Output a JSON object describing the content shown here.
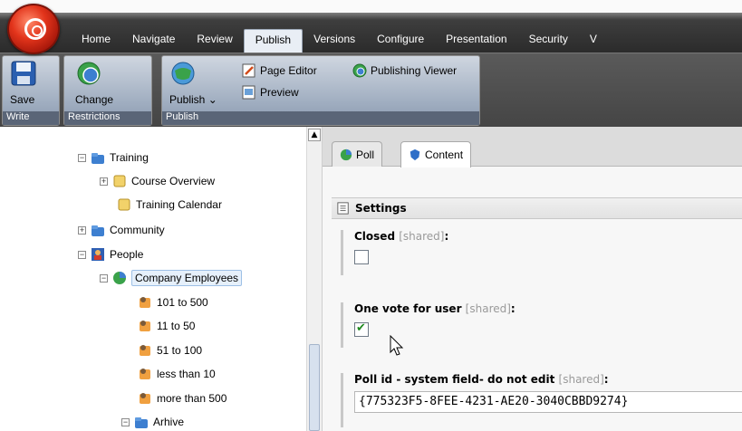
{
  "ribbon": {
    "tabs": [
      "Home",
      "Navigate",
      "Review",
      "Publish",
      "Versions",
      "Configure",
      "Presentation",
      "Security",
      "V"
    ],
    "active_tab": "Publish",
    "groups": {
      "write": {
        "label": "Write",
        "save": "Save"
      },
      "restrictions": {
        "label": "Restrictions",
        "change": "Change"
      },
      "publish": {
        "label": "Publish",
        "publish_btn": "Publish",
        "page_editor": "Page Editor",
        "publishing_viewer": "Publishing Viewer",
        "preview": "Preview"
      }
    }
  },
  "tree": {
    "nodes": [
      {
        "label": "Training",
        "expander": "−"
      },
      {
        "label": "Course Overview",
        "expander": "+"
      },
      {
        "label": "Training Calendar",
        "expander": ""
      },
      {
        "label": "Community",
        "expander": "+"
      },
      {
        "label": "People",
        "expander": "−"
      },
      {
        "label": "Company Employees",
        "expander": "−"
      },
      {
        "label": "101 to 500",
        "expander": ""
      },
      {
        "label": "11 to 50",
        "expander": ""
      },
      {
        "label": "51 to 100",
        "expander": ""
      },
      {
        "label": "less than 10",
        "expander": ""
      },
      {
        "label": "more than 500",
        "expander": ""
      },
      {
        "label": "Arhive",
        "expander": "−"
      }
    ]
  },
  "content": {
    "tabs": [
      "Poll",
      "Content"
    ],
    "active_tab": "Content",
    "section": "Settings",
    "fields": [
      {
        "label": "Closed",
        "shared": "[shared]",
        "suffix": ":",
        "checked": false
      },
      {
        "label": "One vote for user",
        "shared": "[shared]",
        "suffix": ":",
        "checked": true
      },
      {
        "label": "Poll id - system field- do not edit",
        "shared": "[shared]",
        "suffix": ":",
        "value": "{775323F5-8FEE-4231-AE20-3040CBBD9274}"
      }
    ]
  },
  "colors": {
    "accent": "#e2341b",
    "ribbon_dark": "#2b2b2b",
    "selection": "#e6f0fb"
  }
}
